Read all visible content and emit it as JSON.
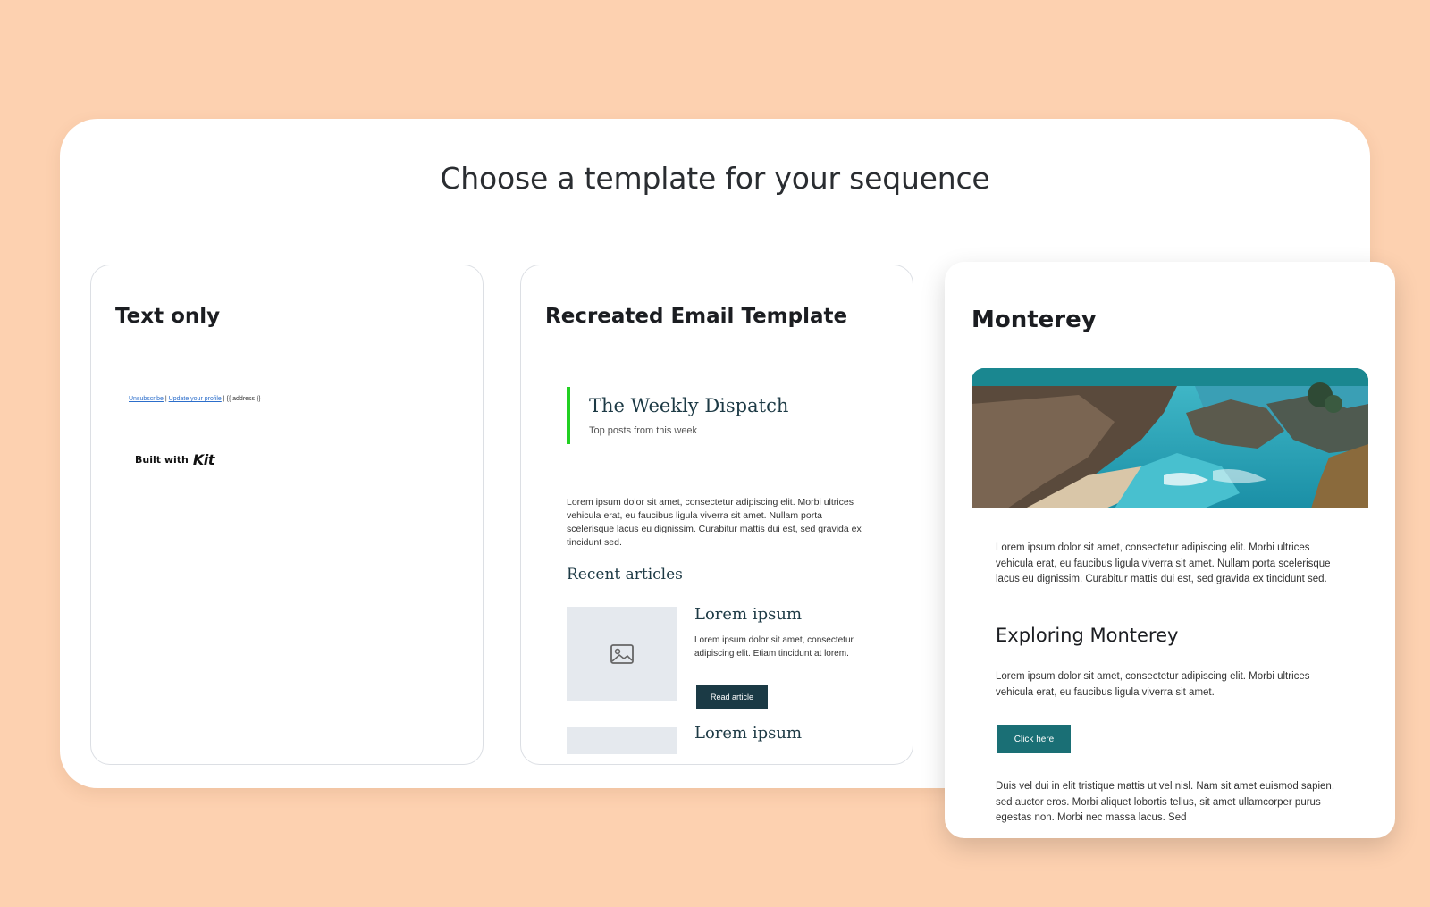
{
  "page": {
    "title": "Choose a template for your sequence"
  },
  "templates": [
    {
      "title": "Text only",
      "footer": {
        "unsubscribe": "Unsubscribe",
        "separator1": " | ",
        "update_profile": "Update your profile",
        "separator2": " | ",
        "address": "{{ address }}"
      },
      "built_with": "Built with",
      "brand": "Kit"
    },
    {
      "title": "Recreated Email Template",
      "newsletter_title": "The Weekly Dispatch",
      "newsletter_subtitle": "Top posts from this week",
      "intro": "Lorem ipsum dolor sit amet, consectetur adipiscing elit. Morbi ultrices vehicula erat, eu faucibus ligula viverra sit amet. Nullam porta scelerisque lacus eu dignissim. Curabitur mattis dui est, sed gravida ex tincidunt sed.",
      "recent_heading": "Recent articles",
      "articles": [
        {
          "title": "Lorem ipsum",
          "text": "Lorem ipsum dolor sit amet, consectetur adipiscing elit. Etiam tincidunt at lorem.",
          "button": "Read article"
        },
        {
          "title": "Lorem ipsum"
        }
      ],
      "accent_color": "#22d022"
    },
    {
      "title": "Monterey",
      "paragraph1": "Lorem ipsum dolor sit amet, consectetur adipiscing elit. Morbi ultrices vehicula erat, eu faucibus ligula viverra sit amet. Nullam porta scelerisque lacus eu dignissim. Curabitur mattis dui est, sed gravida ex tincidunt sed.",
      "heading": "Exploring Monterey",
      "paragraph2": "Lorem ipsum dolor sit amet, consectetur adipiscing elit. Morbi ultrices vehicula erat, eu faucibus ligula viverra sit amet.",
      "button": "Click here",
      "paragraph3": "Duis vel dui in elit tristique mattis ut vel nisl. Nam sit amet euismod sapien, sed auctor eros. Morbi aliquet lobortis tellus, sit amet ullamcorper purus egestas non. Morbi nec massa lacus. Sed",
      "accent_color": "#1a6f75"
    }
  ],
  "colors": {
    "background": "#fdd1b0",
    "panel": "#ffffff",
    "dark_teal": "#1b3a45"
  }
}
